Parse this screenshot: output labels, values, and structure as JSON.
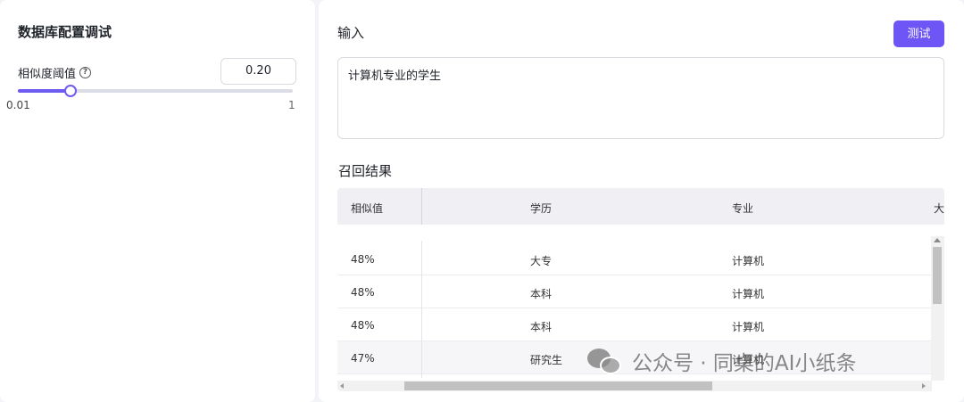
{
  "config": {
    "title": "数据库配置调试",
    "threshold_label": "相似度阈值",
    "help_icon": "?",
    "threshold_value": "0.20",
    "slider": {
      "min_label": "0.01",
      "max_label": "1",
      "value": 0.2,
      "min": 0.01,
      "max": 1
    }
  },
  "input": {
    "title": "输入",
    "test_button": "测试",
    "query": "计算机专业的学生"
  },
  "results": {
    "title": "召回结果",
    "columns": [
      "相似值",
      "学历",
      "专业",
      "大"
    ],
    "rows": [
      [
        "48%",
        "大专",
        "计算机"
      ],
      [
        "48%",
        "本科",
        "计算机"
      ],
      [
        "48%",
        "本科",
        "计算机"
      ],
      [
        "47%",
        "研究生",
        "计算机"
      ]
    ]
  },
  "watermark": {
    "text": "公众号 · 同桌的AI小纸条",
    "icon": "wechat-icon"
  },
  "colors": {
    "accent": "#6e55f5",
    "slider": "#6e5cf0"
  }
}
